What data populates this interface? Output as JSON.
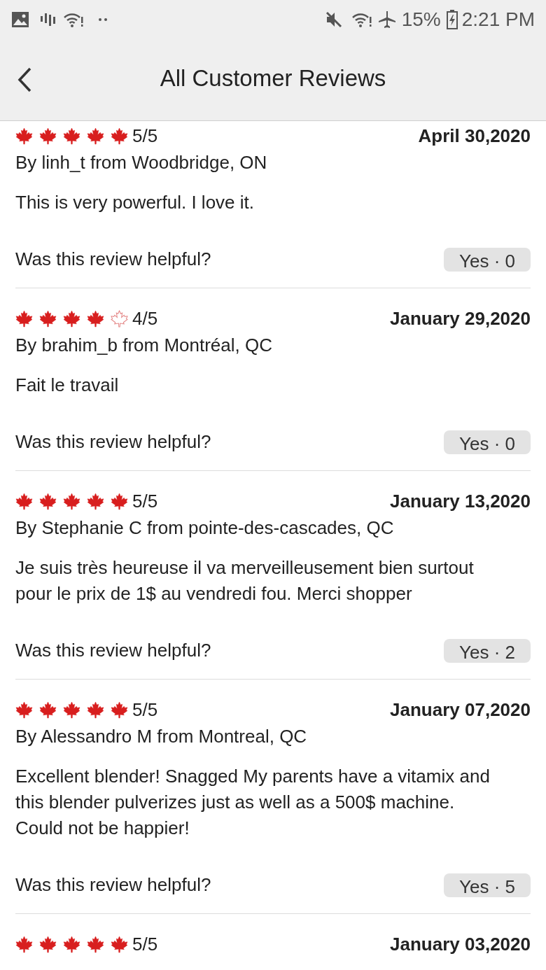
{
  "status_bar": {
    "battery": "15%",
    "time": "2:21 PM"
  },
  "header": {
    "title": "All Customer Reviews"
  },
  "reviews": [
    {
      "stars": 5,
      "rating": "5/5",
      "date": "April 30,2020",
      "author": "By linh_t from Woodbridge, ON",
      "body": "This is very powerful.  I love it.",
      "helpful_label": "Was this review helpful?",
      "helpful_button": "Yes · 0"
    },
    {
      "stars": 4,
      "rating": "4/5",
      "date": "January 29,2020",
      "author": "By brahim_b from Montréal, QC",
      "body": "Fait le travail",
      "helpful_label": "Was this review helpful?",
      "helpful_button": "Yes · 0"
    },
    {
      "stars": 5,
      "rating": "5/5",
      "date": "January 13,2020",
      "author": "By Stephanie  C from pointe-des-cascades, QC",
      "body": "Je suis très heureuse il va merveilleusement bien surtout pour le prix de 1$ au vendredi fou. Merci shopper",
      "helpful_label": "Was this review helpful?",
      "helpful_button": "Yes · 2"
    },
    {
      "stars": 5,
      "rating": "5/5",
      "date": "January 07,2020",
      "author": "By Alessandro  M from Montreal, QC",
      "body": "Excellent blender! Snagged My parents have a vitamix and this blender pulverizes just as well as a 500$ machine. Could not be happier!",
      "helpful_label": "Was this review helpful?",
      "helpful_button": "Yes · 5"
    },
    {
      "stars": 5,
      "rating": "5/5",
      "date": "January 03,2020"
    }
  ]
}
